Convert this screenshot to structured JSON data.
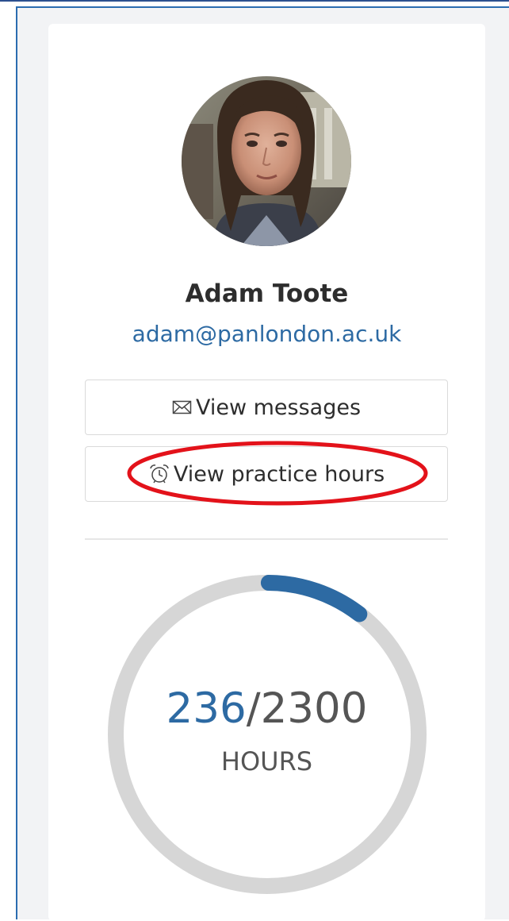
{
  "profile": {
    "name": "Adam Toote",
    "email": "adam@panlondon.ac.uk"
  },
  "actions": {
    "messages_label": "View messages",
    "messages_icon": "envelope-icon",
    "practice_hours_label": "View practice hours",
    "practice_hours_icon": "alarm-clock-icon"
  },
  "progress": {
    "completed": "236",
    "separator": "/",
    "total": "2300",
    "unit": "HOURS",
    "fraction": 0.1026
  },
  "colors": {
    "accent": "#2d6aa3",
    "track": "#d6d6d6",
    "annotation": "#e3121a"
  }
}
